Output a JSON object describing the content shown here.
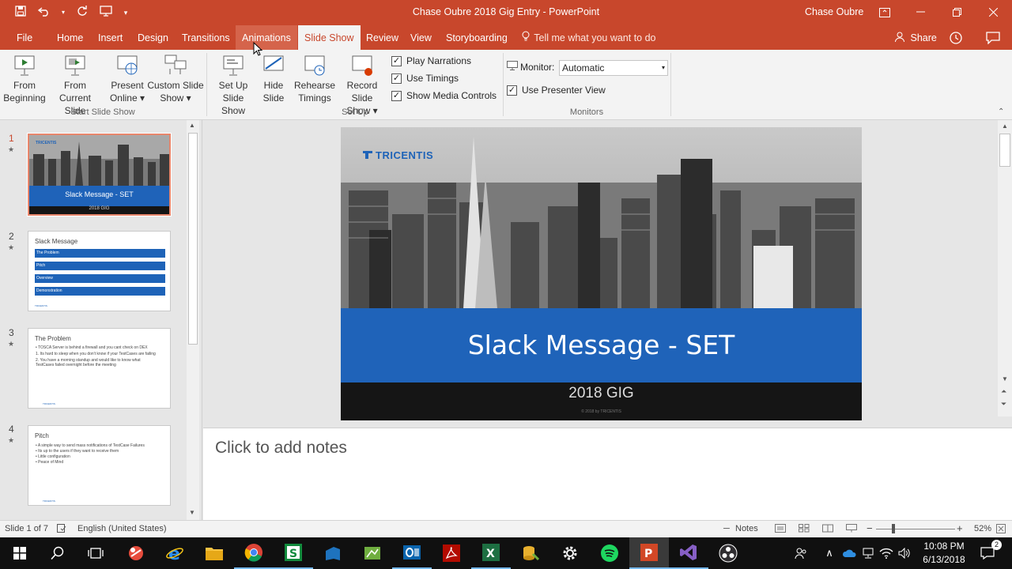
{
  "window": {
    "title": "Chase Oubre 2018 Gig Entry  -  PowerPoint",
    "user": "Chase Oubre",
    "controls": {
      "restore_ribbon": "☐",
      "minimize": "—",
      "maximize": "☐",
      "close": "✕"
    }
  },
  "qat": {
    "save": "💾",
    "undo": "↶",
    "redo": "↻",
    "present": "▣",
    "customize": "▾"
  },
  "tabs": [
    {
      "label": "File"
    },
    {
      "label": "Home"
    },
    {
      "label": "Insert"
    },
    {
      "label": "Design"
    },
    {
      "label": "Transitions"
    },
    {
      "label": "Animations"
    },
    {
      "label": "Slide Show"
    },
    {
      "label": "Review"
    },
    {
      "label": "View"
    },
    {
      "label": "Storyboarding"
    }
  ],
  "tell_me": "Tell me what you want to do",
  "share": "Share",
  "ribbon": {
    "from_beginning": [
      "From",
      "Beginning"
    ],
    "from_current": [
      "From",
      "Current Slide"
    ],
    "present_online": [
      "Present",
      "Online ▾"
    ],
    "custom_show": [
      "Custom Slide",
      "Show ▾"
    ],
    "group_start": "Start Slide Show",
    "setup_show": [
      "Set Up",
      "Slide Show"
    ],
    "hide_slide": [
      "Hide",
      "Slide"
    ],
    "rehearse": [
      "Rehearse",
      "Timings"
    ],
    "record": [
      "Record Slide",
      "Show ▾"
    ],
    "play_narrations": "Play Narrations",
    "use_timings": "Use Timings",
    "show_media": "Show Media Controls",
    "group_setup": "Set Up",
    "monitor_label": "Monitor:",
    "monitor_value": "Automatic",
    "use_presenter": "Use Presenter View",
    "group_monitors": "Monitors",
    "checked": "✓"
  },
  "thumbnails": [
    {
      "num": "1",
      "title": "Slack Message - SET",
      "subtitle": "2018 GIG",
      "logo": "TRICENTIS"
    },
    {
      "num": "2",
      "title": "Slack Message",
      "items": [
        "The Problem",
        "Pitch",
        "Overview",
        "Demonstration"
      ],
      "footer": "TRICENTIS"
    },
    {
      "num": "3",
      "title": "The Problem",
      "lines": [
        "• TOSCA Server is behind a firewall and you cant check on DEX",
        "  1. Its hard to sleep when you don't know if your TestCases are failing",
        "  2. You have a morning standup and would like to know what",
        "      TestCases failed overnight before the meeting"
      ],
      "footer": "TRICENTIS"
    },
    {
      "num": "4",
      "title": "Pitch",
      "lines": [
        "• A simple way to send mass notifications of TestCase Failures",
        "    • Its up to the users if they want to receive them",
        "    • Little configuration",
        "    • Peace of Mind"
      ],
      "footer": "TRICENTIS"
    }
  ],
  "slide": {
    "logo": "TRICENTIS",
    "title": "Slack Message - SET",
    "subtitle": "2018 GIG",
    "footer": "© 2018 by  TRICENTIS"
  },
  "notes_placeholder": "Click to add notes",
  "statusbar": {
    "slide_info": "Slide 1 of 7",
    "language": "English (United States)",
    "notes": "Notes",
    "zoom": "52%",
    "zoom_minus": "−",
    "zoom_plus": "+"
  },
  "taskbar": {
    "time": "10:08 PM",
    "date": "6/13/2018",
    "tray_chevron": "∧",
    "tray_volume": "🔈",
    "tray_wifi": "⌕"
  },
  "colors": {
    "accent": "#c8472c",
    "slide_band": "#1f63b9",
    "selected_thumb_border": "#e8866c"
  }
}
